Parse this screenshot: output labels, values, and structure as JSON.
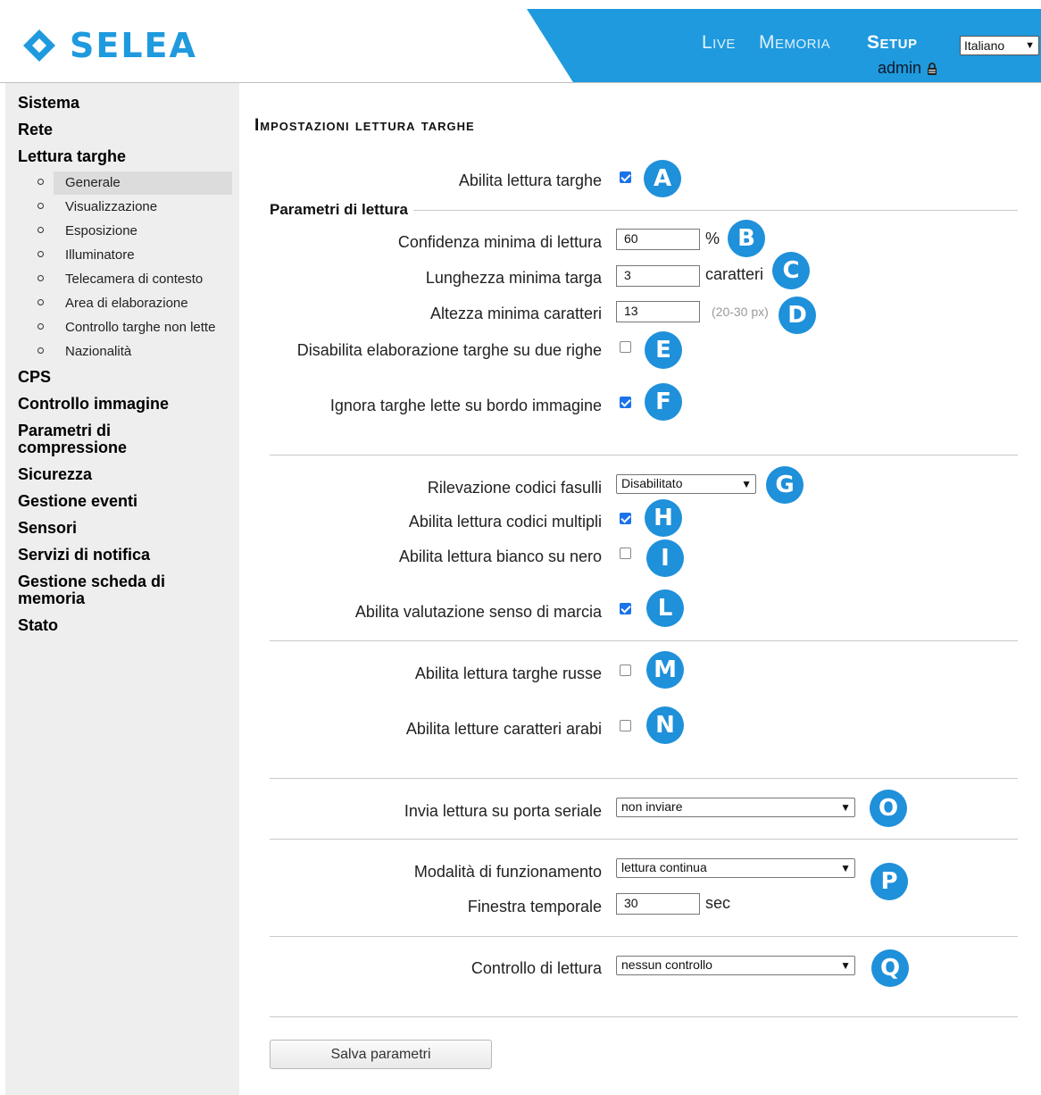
{
  "brand": {
    "logo_text": "SELEA",
    "accent": "#1f9ade"
  },
  "nav": {
    "live": "Live",
    "memoria": "Memoria",
    "setup": "Setup"
  },
  "language": {
    "selected": "Italiano"
  },
  "user": {
    "name": "admin",
    "icon": "lock-icon"
  },
  "sidebar": {
    "sistema": "Sistema",
    "rete": "Rete",
    "lettura_targhe": "Lettura targhe",
    "sub": [
      "Generale",
      "Visualizzazione",
      "Esposizione",
      "Illuminatore",
      "Telecamera di contesto",
      "Area di elaborazione",
      "Controllo targhe non lette",
      "Nazionalità"
    ],
    "cps": "CPS",
    "controllo_immagine": "Controllo immagine",
    "parametri_1": "Parametri di",
    "parametri_2": "compressione",
    "sicurezza": "Sicurezza",
    "gestione_eventi": "Gestione eventi",
    "sensori": "Sensori",
    "servizi_notifica": "Servizi di notifica",
    "gestione_scheda_1": "Gestione scheda di",
    "gestione_scheda_2": "memoria",
    "stato": "Stato"
  },
  "main": {
    "title": "Impostazioni lettura targhe",
    "abilita_lettura": {
      "label": "Abilita lettura targhe",
      "checked": true,
      "badge": "A"
    },
    "parametri_legend": "Parametri di lettura",
    "confidenza": {
      "label": "Confidenza minima di lettura",
      "value": "60",
      "unit": "%",
      "badge": "B"
    },
    "lunghezza": {
      "label": "Lunghezza minima targa",
      "value": "3",
      "unit": "caratteri",
      "badge": "C"
    },
    "altezza": {
      "label": "Altezza minima caratteri",
      "value": "13",
      "hint": "(20-30 px)",
      "badge": "D"
    },
    "disabilita_due_righe": {
      "label": "Disabilita elaborazione targhe su due righe",
      "checked": false,
      "badge": "E"
    },
    "ignora_bordo": {
      "label": "Ignora targhe lette su bordo immagine",
      "checked": true,
      "badge": "F"
    },
    "codici_fasulli": {
      "label": "Rilevazione codici fasulli",
      "selected": "Disabilitato",
      "badge": "G"
    },
    "codici_multipli": {
      "label": "Abilita lettura codici multipli",
      "checked": true,
      "badge": "H"
    },
    "bianco_nero": {
      "label": "Abilita lettura bianco su nero",
      "checked": false,
      "badge": "I"
    },
    "senso_marcia": {
      "label": "Abilita valutazione senso di marcia",
      "checked": true,
      "badge": "L"
    },
    "targhe_russe": {
      "label": "Abilita lettura targhe russe",
      "checked": false,
      "badge": "M"
    },
    "caratteri_arabi": {
      "label": "Abilita letture caratteri arabi",
      "checked": false,
      "badge": "N"
    },
    "porta_seriale": {
      "label": "Invia lettura su porta seriale",
      "selected": "non inviare",
      "badge": "O"
    },
    "modalita": {
      "label": "Modalità di funzionamento",
      "selected": "lettura continua",
      "badge": "P"
    },
    "finestra": {
      "label": "Finestra temporale",
      "value": "30",
      "unit": "sec"
    },
    "controllo": {
      "label": "Controllo di lettura",
      "selected": "nessun controllo",
      "badge": "Q"
    },
    "save_label": "Salva parametri"
  }
}
